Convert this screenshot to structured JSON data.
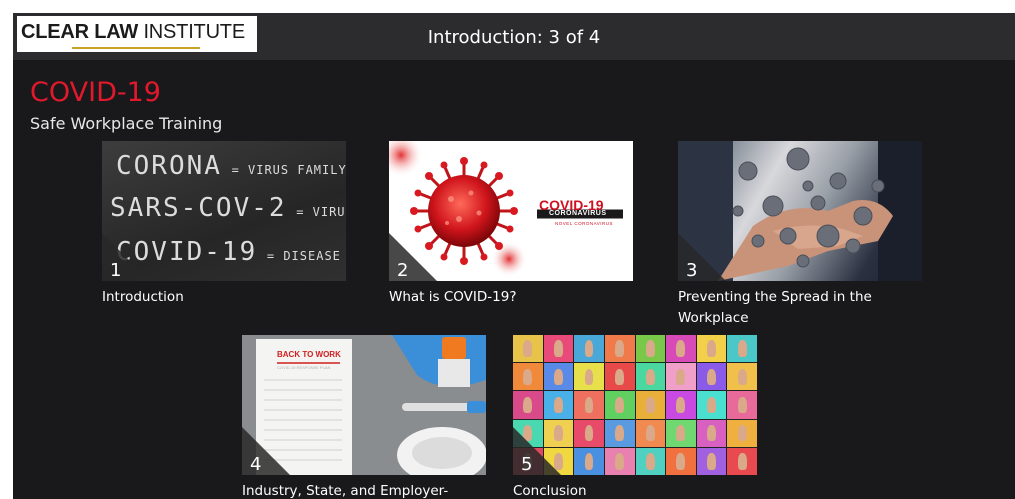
{
  "header": {
    "logo": {
      "bold": "CLEAR LAW",
      "light": "INSTITUTE"
    },
    "progress_text": "Introduction: 3 of 4"
  },
  "course": {
    "title": "COVID-19",
    "subtitle": "Safe Workplace Training"
  },
  "modules": [
    {
      "number": "1",
      "label": "Introduction",
      "image": "chalkboard-image",
      "chalk": {
        "line1": "CORONA",
        "line1_note": "= VIRUS FAMILY",
        "line2": "SARS-COV-2",
        "line2_note": "= VIRUS",
        "line3": "COVID-19",
        "line3_note": "= DISEASE"
      }
    },
    {
      "number": "2",
      "label": "What is COVID-19?",
      "image": "virus-image",
      "badge": {
        "title": "COVID-19",
        "line2": "CORONAVIRUS",
        "line3": "NOVEL CORONAVIRUS"
      }
    },
    {
      "number": "3",
      "label": "Preventing the Spread in the Workplace",
      "image": "handshake-image"
    },
    {
      "number": "4",
      "label": "Industry, State, and Employer-",
      "image": "back-to-work-image",
      "note": {
        "title": "BACK TO WORK",
        "line": "COVID-19 RESPONSE PLAN"
      }
    },
    {
      "number": "5",
      "label": "Conclusion",
      "image": "masked-faces-grid-image"
    }
  ],
  "colors": {
    "accent": "#e0192d",
    "background": "#19181a",
    "topbar": "#2c2c2e",
    "logo_underline": "#c9a227"
  }
}
